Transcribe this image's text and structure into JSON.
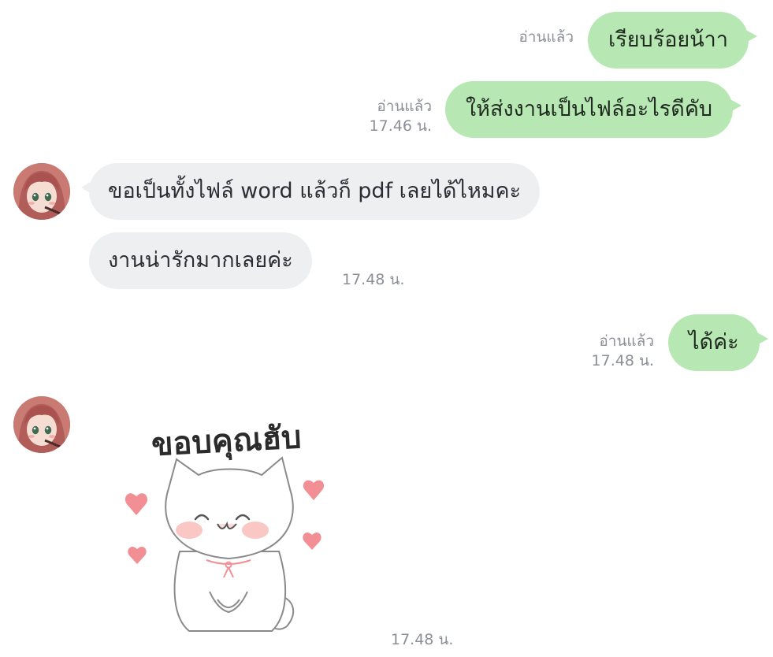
{
  "messages": [
    {
      "id": "m1",
      "direction": "out",
      "text": "เรียบร้อยน้าา",
      "read_label": "อ่านแล้ว",
      "time": ""
    },
    {
      "id": "m2",
      "direction": "out",
      "text": "ให้ส่งงานเป็นไฟล์อะไรดีคับ",
      "read_label": "อ่านแล้ว",
      "time": "17.46 น."
    },
    {
      "id": "m3",
      "direction": "in",
      "text": "ขอเป็นทั้งไฟล์ word แล้วก็ pdf เลยได้ไหมคะ",
      "time": ""
    },
    {
      "id": "m4",
      "direction": "in",
      "text": "งานน่ารักมากเลยค่ะ",
      "time": "17.48 น."
    },
    {
      "id": "m5",
      "direction": "out",
      "text": "ได้ค่ะ",
      "read_label": "อ่านแล้ว",
      "time": "17.48 น."
    },
    {
      "id": "m6",
      "direction": "in",
      "type": "sticker",
      "sticker_text": "ขอบคุณฮับ",
      "time": "17.48 น."
    }
  ],
  "colors": {
    "outgoing_bubble": "#b7e7b3",
    "incoming_bubble": "#eeeff1",
    "meta_text": "#8b8f96",
    "heart": "#f28f95"
  },
  "icons": {
    "avatar": "anime-girl-avatar",
    "sticker": "white-cat-thank-you-sticker"
  }
}
